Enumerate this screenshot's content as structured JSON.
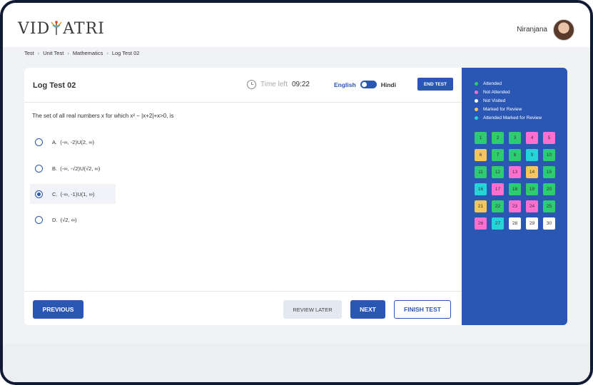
{
  "brand": {
    "logo_left": "VID",
    "logo_right": "ATRI"
  },
  "user": {
    "name": "Niranjana"
  },
  "breadcrumb": [
    "Test",
    "Unit Test",
    "Mathematics",
    "Log Test 02"
  ],
  "header": {
    "title": "Log Test 02",
    "time_label": "Time left",
    "time_value": "09:22",
    "lang_english": "English",
    "lang_hindi": "Hindi",
    "end_test": "END TEST"
  },
  "question": {
    "text": "The set of all real numbers x for which x² − |x+2|+x>0, is",
    "options": [
      {
        "letter": "A.",
        "text": "(-∞, -2)U(2, ∞)"
      },
      {
        "letter": "B.",
        "text": "(-∞, -√2)U(√2, ∞)"
      },
      {
        "letter": "C.",
        "text": "(-∞, -1)U(1, ∞)"
      },
      {
        "letter": "D.",
        "text": "(√2, ∞)"
      }
    ],
    "selected": "C."
  },
  "footer": {
    "previous": "PREVIOUS",
    "review_later": "REVIEW LATER",
    "next": "NEXT",
    "finish_test": "FINISH TEST"
  },
  "legend": [
    {
      "label": "Attended",
      "color": "#2ecc71"
    },
    {
      "label": "Not Attended",
      "color": "#ff6fd0"
    },
    {
      "label": "Not Visited",
      "color": "#ffffff"
    },
    {
      "label": "Marked for Review",
      "color": "#f7c55c"
    },
    {
      "label": "Attended Marked for Review",
      "color": "#26d4d8"
    }
  ],
  "questions_grid": [
    {
      "num": "1",
      "status": "attended"
    },
    {
      "num": "2",
      "status": "attended"
    },
    {
      "num": "3",
      "status": "attended"
    },
    {
      "num": "4",
      "status": "not_attended"
    },
    {
      "num": "5",
      "status": "not_attended"
    },
    {
      "num": "6",
      "status": "marked"
    },
    {
      "num": "7",
      "status": "attended"
    },
    {
      "num": "8",
      "status": "attended"
    },
    {
      "num": "9",
      "status": "attended_marked"
    },
    {
      "num": "10",
      "status": "attended"
    },
    {
      "num": "11",
      "status": "attended"
    },
    {
      "num": "12",
      "status": "attended"
    },
    {
      "num": "13",
      "status": "not_attended"
    },
    {
      "num": "14",
      "status": "marked"
    },
    {
      "num": "15",
      "status": "attended"
    },
    {
      "num": "16",
      "status": "attended_marked"
    },
    {
      "num": "17",
      "status": "not_attended"
    },
    {
      "num": "18",
      "status": "attended"
    },
    {
      "num": "19",
      "status": "attended"
    },
    {
      "num": "20",
      "status": "attended"
    },
    {
      "num": "21",
      "status": "marked"
    },
    {
      "num": "22",
      "status": "attended"
    },
    {
      "num": "23",
      "status": "not_attended"
    },
    {
      "num": "24",
      "status": "not_attended"
    },
    {
      "num": "25",
      "status": "attended"
    },
    {
      "num": "26",
      "status": "not_attended"
    },
    {
      "num": "27",
      "status": "attended_marked"
    },
    {
      "num": "28",
      "status": "not_visited"
    },
    {
      "num": "29",
      "status": "not_visited"
    },
    {
      "num": "30",
      "status": "not_visited"
    }
  ],
  "status_colors": {
    "attended": "#2ecc71",
    "not_attended": "#ff6fd0",
    "not_visited": "#ffffff",
    "marked": "#f7c55c",
    "attended_marked": "#26d4d8"
  }
}
